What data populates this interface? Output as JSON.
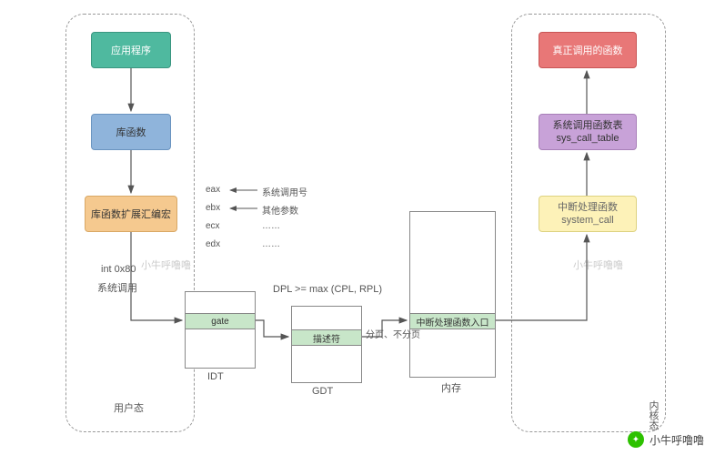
{
  "boxes": {
    "app": "应用程序",
    "libfn": "库函数",
    "libasm": "库函数扩展汇编宏",
    "realfn": "真正调用的函数",
    "syscalltable": "系统调用函数表\nsys_call_table",
    "handler": "中断处理函数\nsystem_call",
    "gate": "gate",
    "descriptor": "描述符",
    "entry": "中断处理函数入口"
  },
  "labels": {
    "int80": "int 0x80",
    "syscall": "系统调用",
    "dpl": "DPL >= max (CPL, RPL)",
    "idt": "IDT",
    "gdt": "GDT",
    "mem": "内存",
    "paging": "分页、不分页",
    "userland": "用户态",
    "kernelland": "内核态",
    "eax": "eax",
    "ebx": "ebx",
    "ecx": "ecx",
    "edx": "edx",
    "syscallno": "系统调用号",
    "otherparam": "其他参数",
    "dots": "……"
  },
  "watermark": "小牛呼噜噜",
  "footer": "小牛呼噜噜"
}
